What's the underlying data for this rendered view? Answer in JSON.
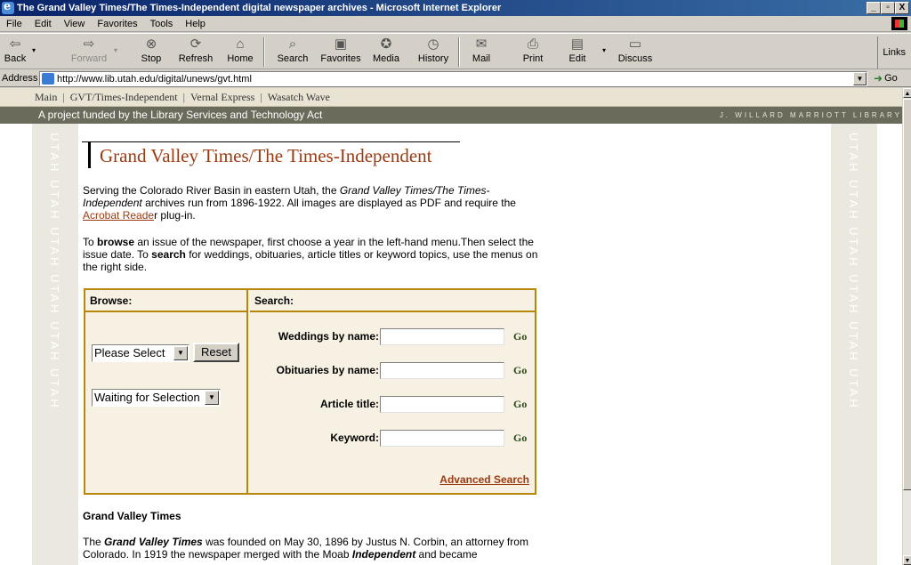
{
  "window": {
    "title": "The Grand Valley Times/The Times-Independent digital newspaper archives - Microsoft Internet Explorer",
    "min_label": "_",
    "max_label": "▫",
    "close_label": "X"
  },
  "menu": [
    "File",
    "Edit",
    "View",
    "Favorites",
    "Tools",
    "Help"
  ],
  "toolbar": {
    "back": "Back",
    "forward": "Forward",
    "stop": "Stop",
    "refresh": "Refresh",
    "home": "Home",
    "search": "Search",
    "favorites": "Favorites",
    "media": "Media",
    "history": "History",
    "mail": "Mail",
    "print": "Print",
    "edit": "Edit",
    "discuss": "Discuss",
    "links": "Links"
  },
  "address": {
    "label": "Address",
    "url": "http://www.lib.utah.edu/digital/unews/gvt.html",
    "go": "Go"
  },
  "site_nav": {
    "main": "Main",
    "gvt": "GVT/Times-Independent",
    "vernal": "Vernal Express",
    "wasatch": "Wasatch Wave"
  },
  "funding": {
    "text": "A project funded by the Library Services and Technology Act",
    "library": "J. WILLARD MARRIOTT LIBRARY"
  },
  "side_watermark": "UTAH UTAH UTAH UTAH UTAH UTAH",
  "page": {
    "heading": "Grand Valley Times/The Times-Independent",
    "intro_1": "Serving the Colorado River Basin in eastern Utah, the ",
    "intro_title": "Grand Valley Times/The Times-Independent",
    "intro_2": " archives run from 1896-1922. All images are displayed as PDF and require the ",
    "acrobat_link": "Acrobat Reade",
    "intro_3": "r plug-in.",
    "howto_1": "To ",
    "howto_browse": "browse",
    "howto_2": " an issue of the newspaper, first choose a year in the left-hand menu.Then select the issue date. To ",
    "howto_search": "search",
    "howto_3": " for weddings, obituaries, article titles or keyword topics, use the menus on the right side.",
    "gvt_heading": "Grand Valley Times",
    "gvt_1": "The ",
    "gvt_title": "Grand Valley Times",
    "gvt_2": " was founded on May 30, 1896 by Justus N. Corbin, an attorney from Colorado. In 1919 the newspaper merged with the Moab ",
    "gvt_independent": "Independent",
    "gvt_3": " and became"
  },
  "browse": {
    "header": "Browse:",
    "year_select": "Please Select",
    "reset": "Reset",
    "issue_select": "Waiting for Selection"
  },
  "search": {
    "header": "Search:",
    "weddings_label": "Weddings by name:",
    "obituaries_label": "Obituaries by name:",
    "article_label": "Article title:",
    "keyword_label": "Keyword:",
    "go": "Go",
    "advanced": "Advanced Search"
  }
}
